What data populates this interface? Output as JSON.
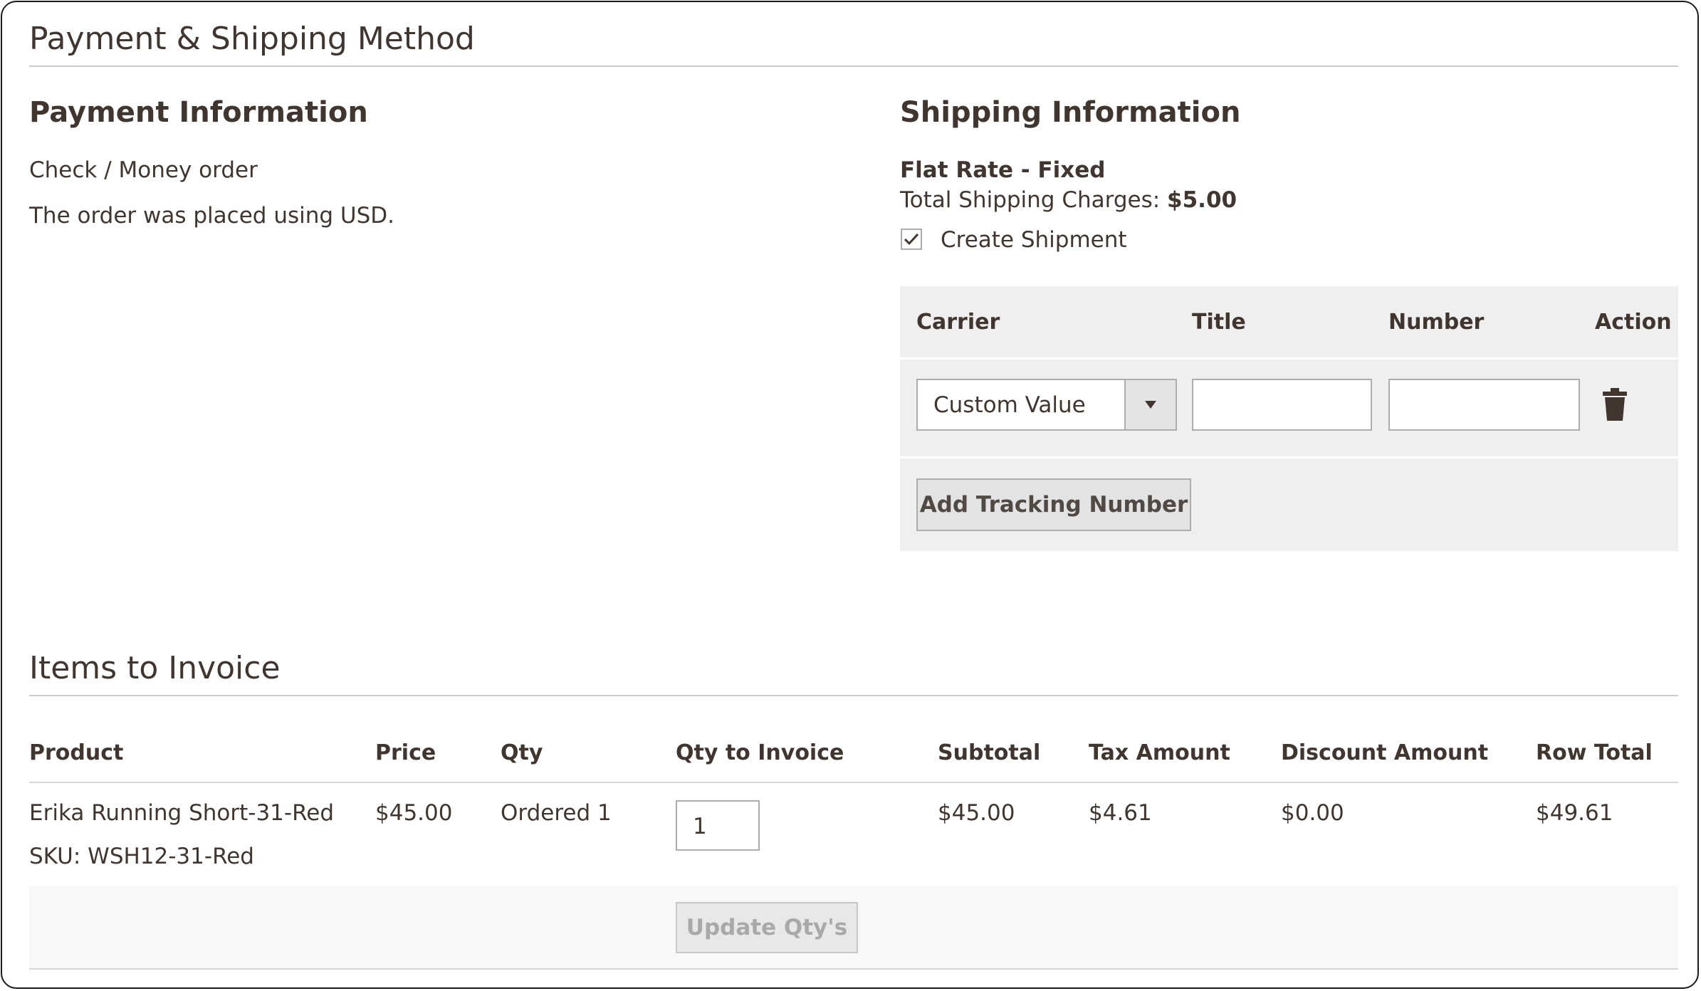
{
  "section": {
    "title": "Payment & Shipping Method"
  },
  "payment": {
    "heading": "Payment Information",
    "method": "Check / Money order",
    "currency_note": "The order was placed using USD."
  },
  "shipping": {
    "heading": "Shipping Information",
    "method": "Flat Rate - Fixed",
    "charges_label": "Total Shipping Charges:",
    "charges_value": "$5.00",
    "create_shipment_label": "Create Shipment",
    "create_shipment_checked": true,
    "tracking": {
      "headers": {
        "carrier": "Carrier",
        "title": "Title",
        "number": "Number",
        "action": "Action"
      },
      "row": {
        "carrier_value": "Custom Value",
        "title_value": "",
        "number_value": ""
      },
      "add_button": "Add Tracking Number"
    }
  },
  "items": {
    "title": "Items to Invoice",
    "headers": {
      "product": "Product",
      "price": "Price",
      "qty": "Qty",
      "qty_to_invoice": "Qty to Invoice",
      "subtotal": "Subtotal",
      "tax_amount": "Tax Amount",
      "discount_amount": "Discount Amount",
      "row_total": "Row Total"
    },
    "rows": [
      {
        "product_name": "Erika Running Short-31-Red",
        "sku": "SKU: WSH12-31-Red",
        "price": "$45.00",
        "qty": "Ordered 1",
        "qty_to_invoice": "1",
        "subtotal": "$45.00",
        "tax_amount": "$4.61",
        "discount_amount": "$0.00",
        "row_total": "$49.61"
      }
    ],
    "update_button": "Update Qty's"
  },
  "icons": {
    "checkmark": "checkmark-icon",
    "dropdown": "chevron-down-icon",
    "delete": "trash-icon"
  }
}
